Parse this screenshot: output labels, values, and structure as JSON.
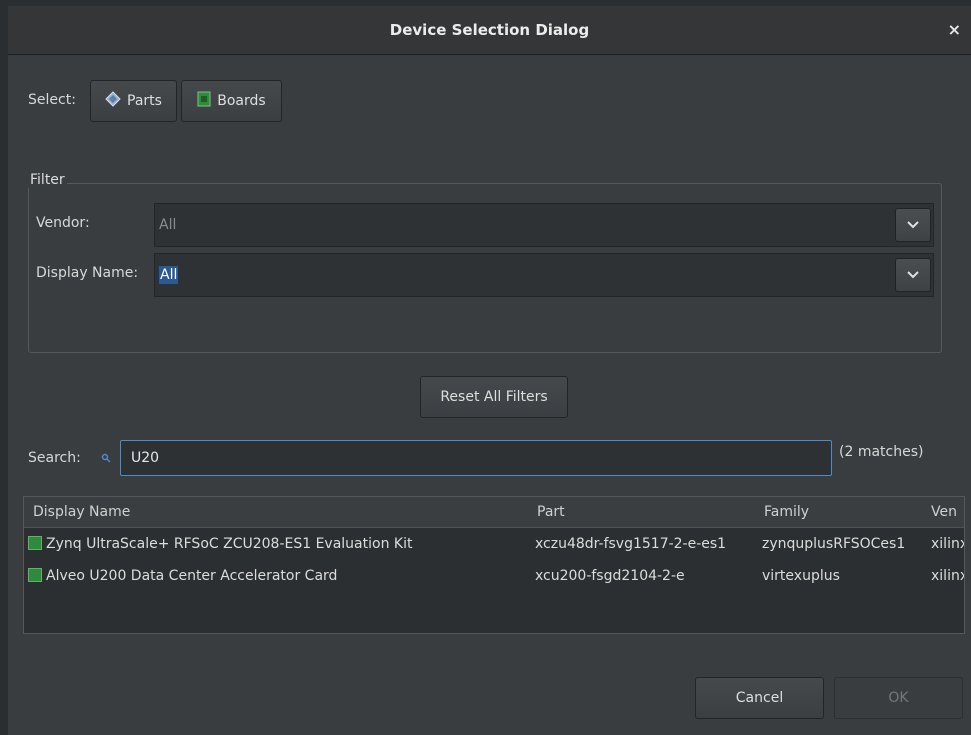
{
  "window": {
    "title": "Device Selection Dialog",
    "close_glyph": "×"
  },
  "select": {
    "label": "Select:",
    "parts_label": "Parts",
    "boards_label": "Boards"
  },
  "filter": {
    "legend": "Filter",
    "vendor_label": "Vendor:",
    "vendor_value": "All",
    "display_name_label": "Display Name:",
    "display_name_value": "All"
  },
  "reset_label": "Reset All Filters",
  "search": {
    "label": "Search:",
    "value": "U20",
    "matches": "(2 matches)"
  },
  "table": {
    "columns": [
      "Display Name",
      "Part",
      "Family",
      "Ven"
    ],
    "rows": [
      {
        "name": "Zynq UltraScale+ RFSoC ZCU208-ES1 Evaluation Kit",
        "part": "xczu48dr-fsvg1517-2-e-es1",
        "family": "zynquplusRFSOCes1",
        "vendor": "xilinx"
      },
      {
        "name": "Alveo U200 Data Center Accelerator Card",
        "part": "xcu200-fsgd2104-2-e",
        "family": "virtexuplus",
        "vendor": "xilinx"
      }
    ]
  },
  "footer": {
    "cancel_label": "Cancel",
    "ok_label": "OK"
  },
  "colors": {
    "accent": "#4f8ac9",
    "selection": "#2a5a94",
    "board_green": "#2e8b3e"
  }
}
